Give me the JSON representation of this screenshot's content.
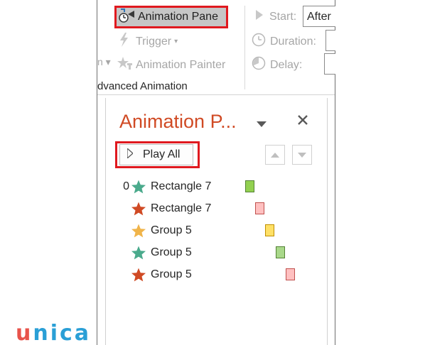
{
  "ribbon": {
    "animation_pane_label": "Animation Pane",
    "trigger_label": "Trigger",
    "animation_painter_label": "Animation Painter",
    "group_label": "dvanced Animation",
    "start_label": "Start:",
    "start_value": "After",
    "duration_label": "Duration:",
    "delay_label": "Delay:"
  },
  "pane": {
    "title": "Animation P...",
    "play_all_label": "Play All",
    "items": [
      {
        "order": "0",
        "name": "Rectangle 7",
        "star_color": "#4aaa8c",
        "bar_fill": "#92d050",
        "bar_border": "#548235"
      },
      {
        "order": "",
        "name": "Rectangle 7",
        "star_color": "#d04a24",
        "bar_fill": "#ffc0c0",
        "bar_border": "#c0504d"
      },
      {
        "order": "",
        "name": "Group 5",
        "star_color": "#f0b44a",
        "bar_fill": "#ffe066",
        "bar_border": "#bf8f00"
      },
      {
        "order": "",
        "name": "Group 5",
        "star_color": "#4aaa8c",
        "bar_fill": "#a9d88a",
        "bar_border": "#548235"
      },
      {
        "order": "",
        "name": "Group 5",
        "star_color": "#d04a24",
        "bar_fill": "#ffc0c0",
        "bar_border": "#c0504d"
      }
    ]
  },
  "logo": {
    "first": "u",
    "rest": "nica"
  },
  "colors": {
    "highlight": "#e0191f",
    "title": "#d04a24",
    "logo_u": "#e8534b",
    "logo_rest": "#2a9fd6"
  }
}
